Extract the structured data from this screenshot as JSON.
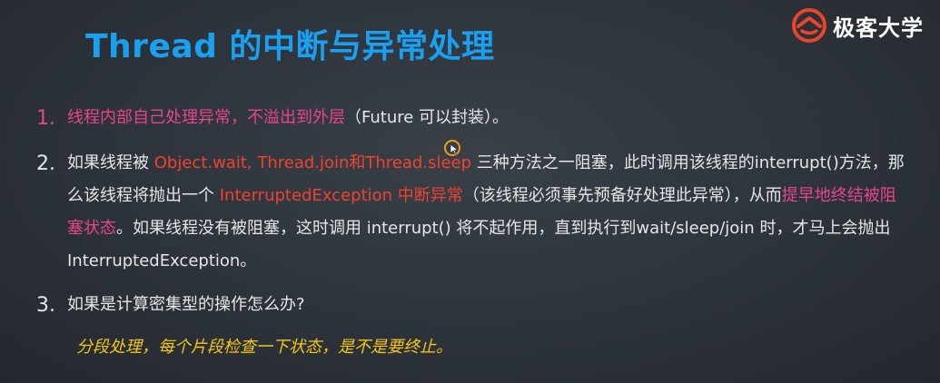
{
  "slide": {
    "title": "Thread 的中断与异常处理",
    "logo_text": "极客大学"
  },
  "colors": {
    "title": "#1aa0f0",
    "highlight_red": "#f0432f",
    "highlight_pink": "#e8458b",
    "highlight_yellow": "#f5c518"
  },
  "items": [
    {
      "number": "1.",
      "highlight": "线程内部自己处理异常，不溢出到外层",
      "rest": "（Future 可以封装）。"
    },
    {
      "number": "2.",
      "t1": "如果线程被 ",
      "h1": "Object.wait, Thread.join和Thread.sleep",
      "t2": " 三种方法之一阻塞，此时调用该线程的interrupt()方法，那么该线程将抛出一个 ",
      "h2": "InterruptedException 中断异常",
      "t3": "（该线程必须事先预备好处理此异常），从而",
      "h3": "提早地终结被阻塞状态",
      "t4": "。如果线程没有被阻塞，这时调用 interrupt() 将不起作用，直到执行到wait/sleep/join 时，才马上会抛出InterruptedException。"
    },
    {
      "number": "3.",
      "text": "如果是计算密集型的操作怎么办?"
    }
  ],
  "sub_note": "分段处理，每个片段检查一下状态，是不是要终止。",
  "icons": {
    "logo": "geek-university-logo-icon",
    "cursor": "mouse-cursor-icon"
  }
}
